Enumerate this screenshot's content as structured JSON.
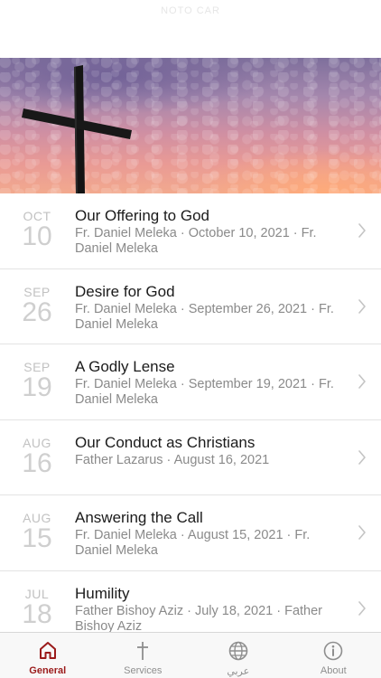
{
  "status_bar": {
    "faint_text": "NOTO CAR"
  },
  "sermons": [
    {
      "month": "OCT",
      "day": "10",
      "title": "Our Offering to God",
      "subtitle": "Fr. Daniel Meleka · October 10, 2021 · Fr. Daniel Meleka"
    },
    {
      "month": "SEP",
      "day": "26",
      "title": "Desire for God",
      "subtitle": "Fr. Daniel Meleka · September 26, 2021 · Fr. Daniel Meleka"
    },
    {
      "month": "SEP",
      "day": "19",
      "title": "A Godly Lense",
      "subtitle": "Fr. Daniel Meleka · September 19, 2021 · Fr. Daniel Meleka"
    },
    {
      "month": "AUG",
      "day": "16",
      "title": "Our Conduct as Christians",
      "subtitle": "Father Lazarus · August 16, 2021"
    },
    {
      "month": "AUG",
      "day": "15",
      "title": "Answering the Call",
      "subtitle": "Fr. Daniel Meleka · August 15, 2021 · Fr. Daniel Meleka"
    },
    {
      "month": "JUL",
      "day": "18",
      "title": "Humility",
      "subtitle": "Father Bishoy Aziz · July 18, 2021 · Father Bishoy Aziz"
    }
  ],
  "tabs": [
    {
      "id": "general",
      "label": "General",
      "icon": "home-icon",
      "active": true
    },
    {
      "id": "services",
      "label": "Services",
      "icon": "cross-icon",
      "active": false
    },
    {
      "id": "arabic",
      "label": "عربي",
      "icon": "globe-icon",
      "active": false
    },
    {
      "id": "about",
      "label": "About",
      "icon": "info-icon",
      "active": false
    }
  ],
  "colors": {
    "accent": "#9b1b1b",
    "inactive": "#8e8e8e"
  }
}
